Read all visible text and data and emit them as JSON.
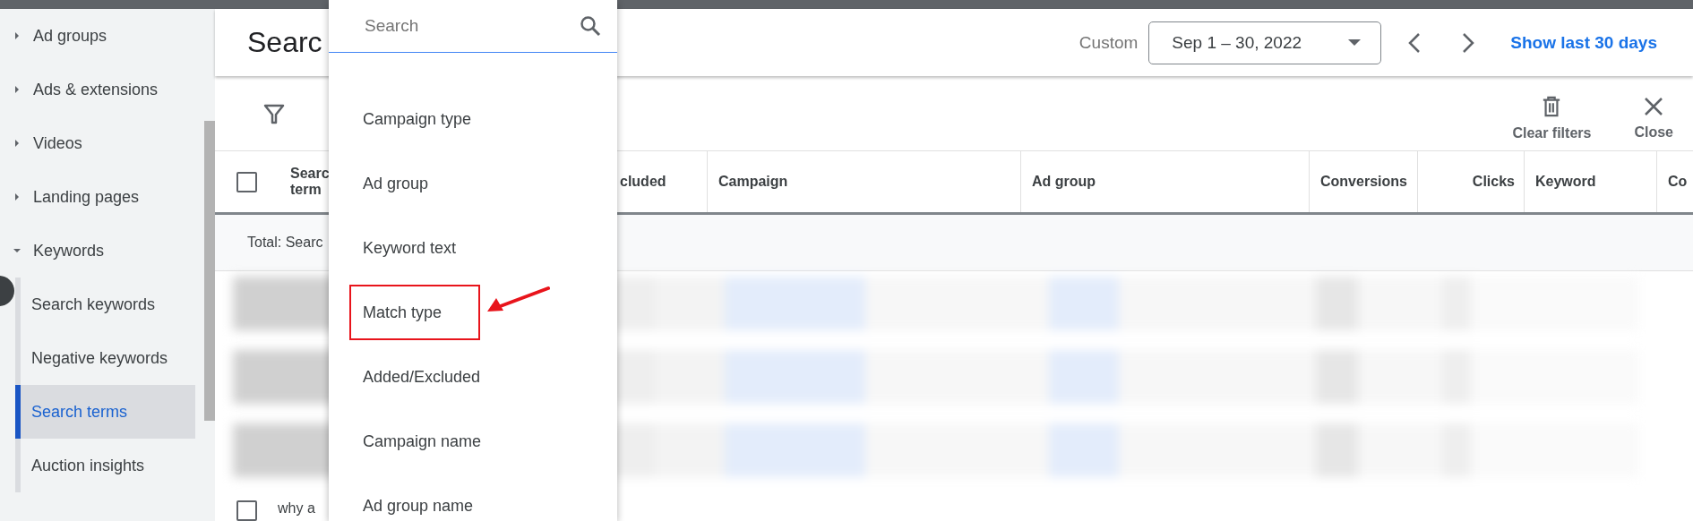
{
  "sidebar": {
    "items": [
      {
        "label": "Ad groups",
        "expanded": false
      },
      {
        "label": "Ads & extensions",
        "expanded": false
      },
      {
        "label": "Videos",
        "expanded": false
      },
      {
        "label": "Landing pages",
        "expanded": false
      },
      {
        "label": "Keywords",
        "expanded": true,
        "children": [
          {
            "label": "Search keywords",
            "selected": false
          },
          {
            "label": "Negative keywords",
            "selected": false
          },
          {
            "label": "Search terms",
            "selected": true
          },
          {
            "label": "Auction insights",
            "selected": false
          }
        ]
      }
    ]
  },
  "header": {
    "title": "Searc",
    "date_label": "Custom",
    "date_value": "Sep 1 – 30, 2022",
    "link": "Show last 30 days"
  },
  "toolbar": {
    "actions": [
      {
        "kind": "trash",
        "label": "Clear filters"
      },
      {
        "kind": "close",
        "label": "Close"
      }
    ]
  },
  "table": {
    "columns": [
      "Searc term",
      "cluded",
      "Campaign",
      "Ad group",
      "Conversions",
      "Clicks",
      "Keyword",
      "Co"
    ],
    "select_all_checked": false,
    "total_label": "Total: Searc",
    "last_row": {
      "checked": false,
      "text": "why a"
    }
  },
  "dropdown": {
    "placeholder": "Search",
    "items": [
      {
        "label": "Campaign type",
        "highlighted": false
      },
      {
        "label": "Ad group",
        "highlighted": false
      },
      {
        "label": "Keyword text",
        "highlighted": false
      },
      {
        "label": "Match type",
        "highlighted": true
      },
      {
        "label": "Added/Excluded",
        "highlighted": false
      },
      {
        "label": "Campaign name",
        "highlighted": false
      },
      {
        "label": "Ad group name",
        "highlighted": false
      }
    ]
  }
}
